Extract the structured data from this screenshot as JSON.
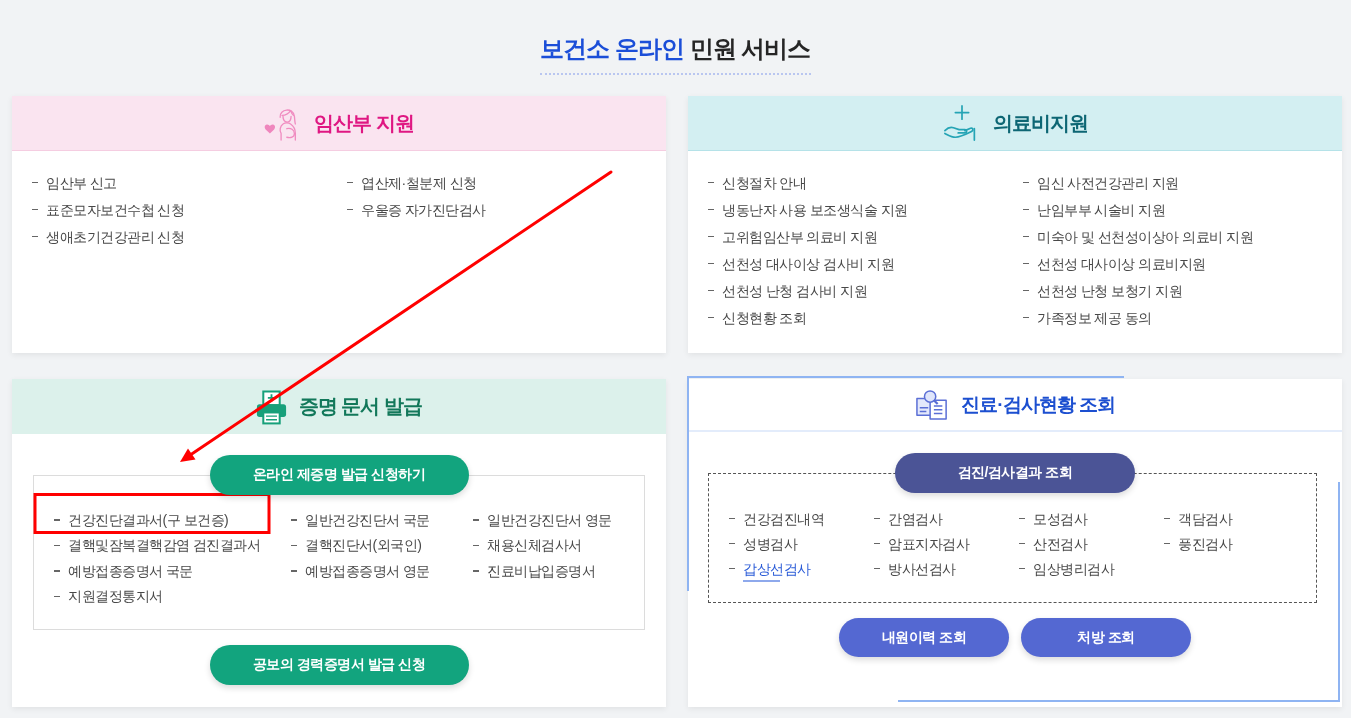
{
  "title": {
    "accent": "보건소 온라인",
    "text": "민원 서비스"
  },
  "panels": [
    {
      "kind": "pregnancy",
      "title": "임산부 지원",
      "items": [
        {
          "label": "임산부 신고"
        },
        {
          "label": "엽산제·철분제 신청"
        },
        {
          "label": "표준모자보건수첩 신청"
        },
        {
          "label": "우울증 자가진단검사"
        },
        {
          "label": "생애초기건강관리 신청"
        }
      ]
    },
    {
      "kind": "medical",
      "title": "의료비지원",
      "items": [
        {
          "label": "신청절차 안내"
        },
        {
          "label": "임신 사전건강관리 지원"
        },
        {
          "label": "냉동난자 사용 보조생식술 지원"
        },
        {
          "label": "난임부부 시술비 지원"
        },
        {
          "label": "고위험임산부 의료비 지원"
        },
        {
          "label": "미숙아 및 선천성이상아 의료비 지원"
        },
        {
          "label": "선천성 대사이상 검사비 지원"
        },
        {
          "label": "선천성 대사이상 의료비지원"
        },
        {
          "label": "선천성 난청 검사비 지원"
        },
        {
          "label": "선천성 난청 보청기 지원"
        },
        {
          "label": "신청현황 조회"
        },
        {
          "label": "가족정보 제공 동의"
        }
      ]
    },
    {
      "kind": "certificate",
      "title": "증명 문서 발급",
      "top_button": "온라인 제증명 발급 신청하기",
      "items": [
        {
          "label": "건강진단결과서(구 보건증)"
        },
        {
          "label": "일반건강진단서 국문"
        },
        {
          "label": "일반건강진단서 영문"
        },
        {
          "label": "결핵및잠복결핵감염 검진결과서"
        },
        {
          "label": "결핵진단서(외국인)"
        },
        {
          "label": "채용신체검사서"
        },
        {
          "label": "예방접종증명서 국문"
        },
        {
          "label": "예방접종증명서 영문"
        },
        {
          "label": "진료비납입증명서"
        },
        {
          "label": "지원결정통지서"
        }
      ],
      "bottom_button": "공보의 경력증명서 발급 신청"
    },
    {
      "kind": "checkup",
      "title": "진료·검사현황 조회",
      "box_button": "검진/검사결과 조회",
      "items": [
        {
          "label": "건강검진내역",
          "selected": false
        },
        {
          "label": "간염검사",
          "selected": false
        },
        {
          "label": "모성검사",
          "selected": false
        },
        {
          "label": "객담검사",
          "selected": false
        },
        {
          "label": "성병검사",
          "selected": false
        },
        {
          "label": "암표지자검사",
          "selected": false
        },
        {
          "label": "산전검사",
          "selected": false
        },
        {
          "label": "풍진검사",
          "selected": false
        },
        {
          "label": "갑상선검사",
          "selected": true
        },
        {
          "label": "방사선검사",
          "selected": false
        },
        {
          "label": "임상병리검사",
          "selected": false
        }
      ],
      "buttons": [
        "내원이력 조회",
        "처방 조회"
      ]
    }
  ]
}
